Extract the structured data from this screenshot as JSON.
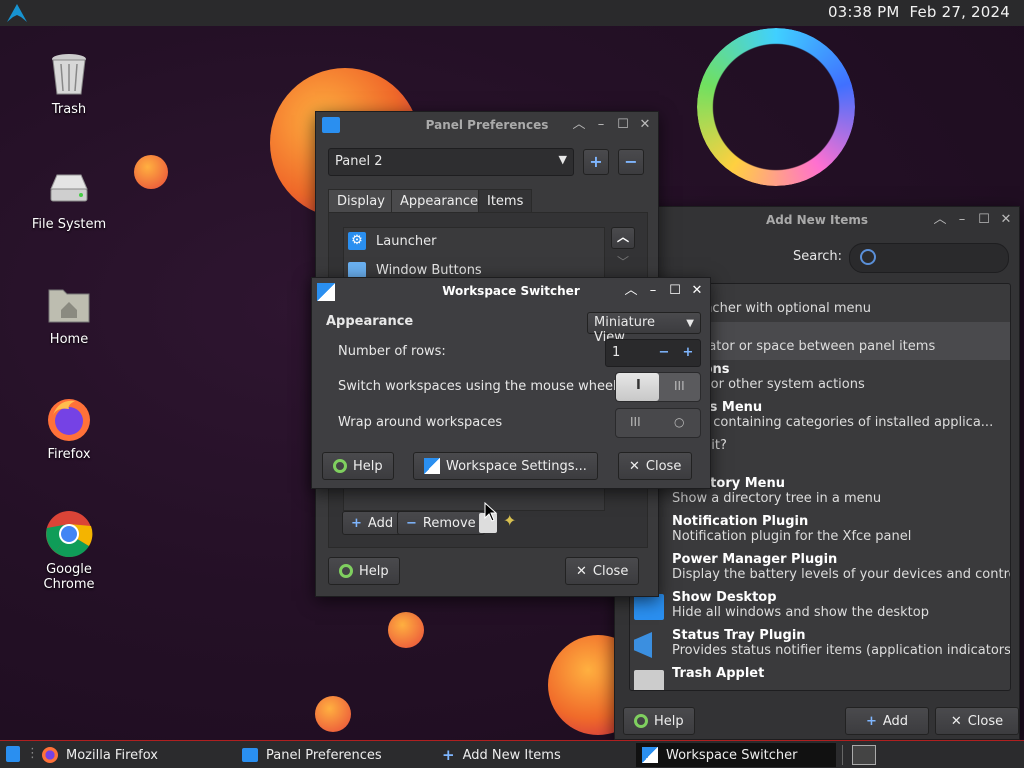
{
  "topbar": {
    "time": "03:38 PM",
    "date": "Feb 27, 2024",
    "logo_icon": "arch-linux-icon"
  },
  "desktop_icons": [
    {
      "label": "Trash",
      "icon": "trash-icon"
    },
    {
      "label": "File System",
      "icon": "drive-icon"
    },
    {
      "label": "Home",
      "icon": "home-folder-icon"
    },
    {
      "label": "Firefox",
      "icon": "firefox-icon"
    },
    {
      "label": "Google Chrome",
      "icon": "chrome-icon"
    }
  ],
  "panel_prefs": {
    "title": "Panel Preferences",
    "panel_select": "Panel 2",
    "tabs": [
      "Display",
      "Appearance",
      "Items"
    ],
    "selected_tab": "Items",
    "items": [
      "Launcher",
      "Window Buttons"
    ],
    "add_label": "Add",
    "remove_label": "Remove",
    "help_label": "Help",
    "close_label": "Close"
  },
  "add_items": {
    "title": "Add New Items",
    "search_label": "Search:",
    "search_value": "",
    "items": [
      {
        "title": "ner",
        "desc": "n launcher with optional menu"
      },
      {
        "title": "tor",
        "desc": "separator or space between panel items"
      },
      {
        "title": "Buttons",
        "desc": ", lock or other system actions"
      },
      {
        "title": "ations Menu",
        "desc": "menu containing categories of installed applica..."
      },
      {
        "title": "",
        "desc": "me is it?"
      },
      {
        "title": "Directory Menu",
        "desc": "Show a directory tree in a menu"
      },
      {
        "title": "Notification Plugin",
        "desc": "Notification plugin for the Xfce panel"
      },
      {
        "title": "Power Manager Plugin",
        "desc": "Display the battery levels of your devices and control t..."
      },
      {
        "title": "Show Desktop",
        "desc": "Hide all windows and show the desktop"
      },
      {
        "title": "Status Tray Plugin",
        "desc": "Provides status notifier items (application indicators) a..."
      },
      {
        "title": "Trash Applet",
        "desc": ""
      }
    ],
    "help_label": "Help",
    "add_label": "Add",
    "close_label": "Close"
  },
  "workspace": {
    "title": "Workspace Switcher",
    "appearance_label": "Appearance",
    "appearance_value": "Miniature View",
    "rows_label": "Number of rows:",
    "rows_value": "1",
    "wheel_label": "Switch workspaces using the mouse wheel",
    "wheel_on": true,
    "wrap_label": "Wrap around workspaces",
    "wrap_on": false,
    "help_label": "Help",
    "settings_label": "Workspace Settings...",
    "close_label": "Close"
  },
  "taskbar": {
    "tasks": [
      "Mozilla Firefox",
      "Panel Preferences",
      "Add New Items",
      "Workspace Switcher"
    ],
    "active": "Workspace Switcher"
  },
  "colors": {
    "accent": "#4a90d9",
    "taskbar_border": "#b02020"
  }
}
